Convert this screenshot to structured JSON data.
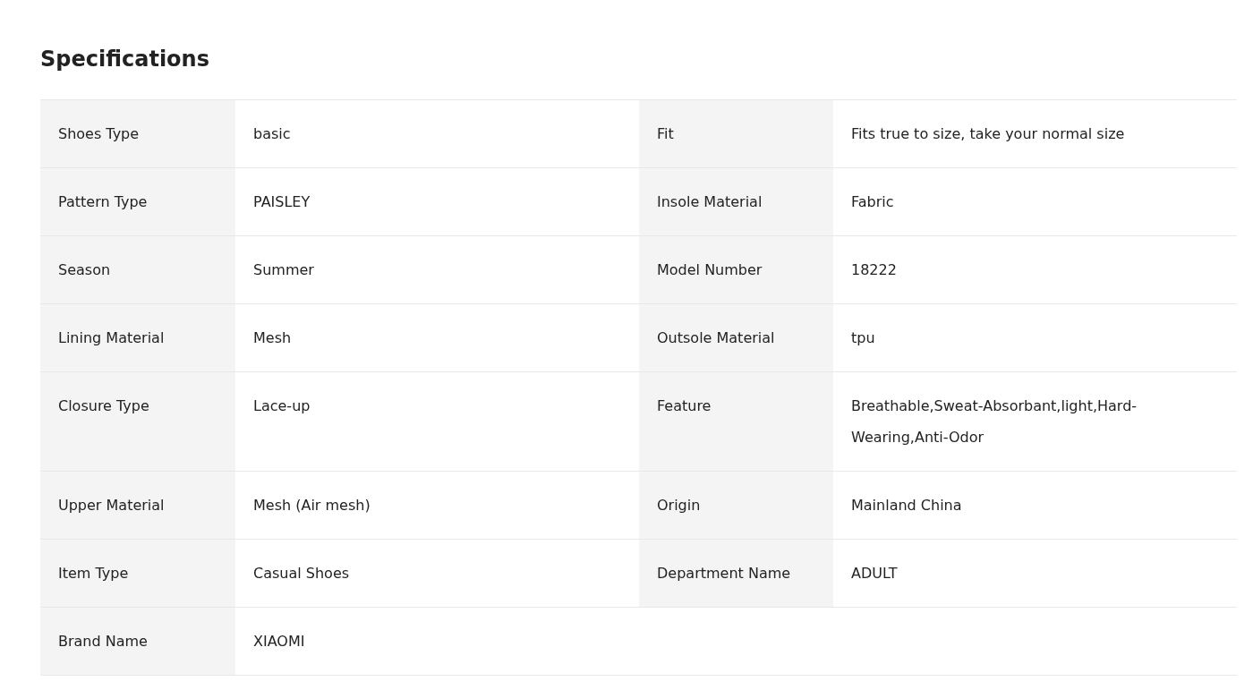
{
  "title": "Specifications",
  "rows": [
    {
      "cells": [
        {
          "label": "Shoes Type",
          "value": "basic"
        },
        {
          "label": "Fit",
          "value": "Fits true to size, take your normal size"
        }
      ]
    },
    {
      "cells": [
        {
          "label": "Pattern Type",
          "value": "PAISLEY"
        },
        {
          "label": "Insole Material",
          "value": "Fabric"
        }
      ]
    },
    {
      "cells": [
        {
          "label": "Season",
          "value": "Summer"
        },
        {
          "label": "Model Number",
          "value": "18222"
        }
      ]
    },
    {
      "cells": [
        {
          "label": "Lining Material",
          "value": "Mesh"
        },
        {
          "label": "Outsole Material",
          "value": "tpu"
        }
      ]
    },
    {
      "cells": [
        {
          "label": "Closure Type",
          "value": "Lace-up"
        },
        {
          "label": "Feature",
          "value": "Breathable,Sweat-Absorbant,light,Hard-Wearing,Anti-Odor"
        }
      ]
    },
    {
      "cells": [
        {
          "label": "Upper Material",
          "value": "Mesh (Air mesh)"
        },
        {
          "label": "Origin",
          "value": "Mainland China"
        }
      ]
    },
    {
      "cells": [
        {
          "label": "Item Type",
          "value": "Casual Shoes"
        },
        {
          "label": "Department Name",
          "value": "ADULT"
        }
      ]
    },
    {
      "cells": [
        {
          "label": "Brand Name",
          "value": "XIAOMI"
        }
      ]
    }
  ]
}
